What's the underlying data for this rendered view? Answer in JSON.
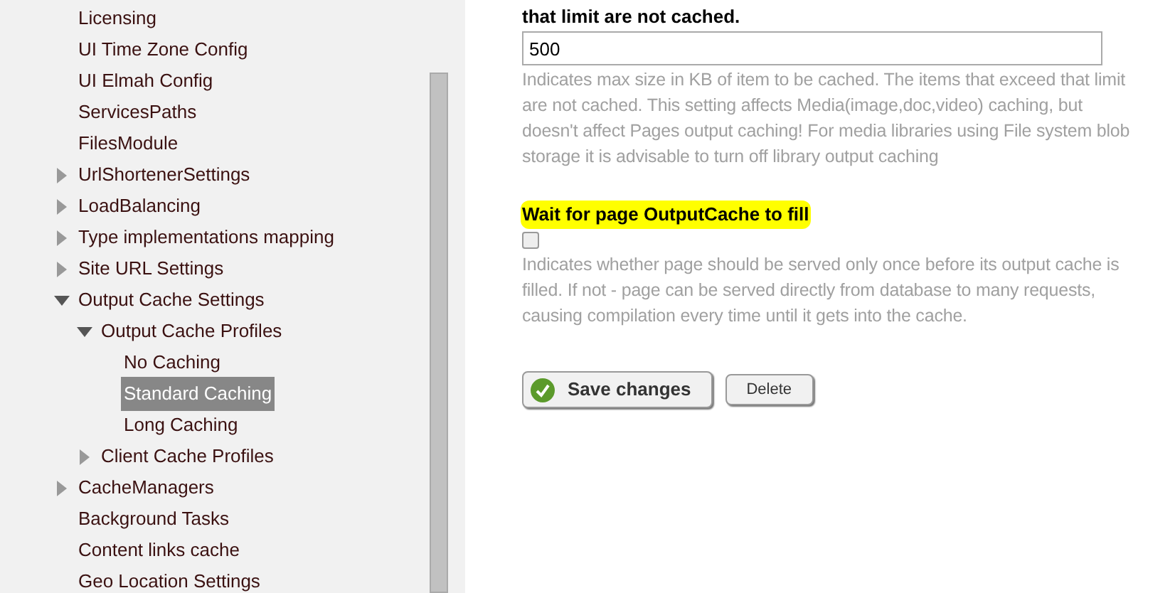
{
  "sidebar": {
    "tree": [
      {
        "label": "Licensing",
        "selected": false
      },
      {
        "label": "UI Time Zone Config",
        "selected": false
      },
      {
        "label": "UI Elmah Config",
        "selected": false
      },
      {
        "label": "ServicesPaths",
        "selected": false
      },
      {
        "label": "FilesModule",
        "selected": false
      },
      {
        "label": "UrlShortenerSettings",
        "selected": false,
        "expanded": false
      },
      {
        "label": "LoadBalancing",
        "selected": false,
        "expanded": false
      },
      {
        "label": "Type implementations mapping",
        "selected": false,
        "expanded": false
      },
      {
        "label": "Site URL Settings",
        "selected": false,
        "expanded": false
      },
      {
        "label": "Output Cache Settings",
        "selected": false,
        "expanded": true,
        "children": [
          {
            "label": "Output Cache Profiles",
            "selected": false,
            "expanded": true,
            "children": [
              {
                "label": "No Caching",
                "selected": false
              },
              {
                "label": "Standard Caching",
                "selected": true
              },
              {
                "label": "Long Caching",
                "selected": false
              }
            ]
          },
          {
            "label": "Client Cache Profiles",
            "selected": false,
            "expanded": false
          }
        ]
      },
      {
        "label": "CacheManagers",
        "selected": false,
        "expanded": false
      },
      {
        "label": "Background Tasks",
        "selected": false
      },
      {
        "label": "Content links cache",
        "selected": false
      },
      {
        "label": "Geo Location Settings",
        "selected": false
      }
    ]
  },
  "form": {
    "fields": [
      {
        "kind": "text",
        "label": "that limit are not cached.",
        "highlighted": false,
        "value": "500",
        "help": "Indicates max size in KB of item to be cached. The items that exceed that limit are not cached. This setting affects Media(image,doc,video) caching, but doesn't affect Pages output caching! For media libraries using File system blob storage it is advisable to turn off library output caching"
      },
      {
        "kind": "checkbox",
        "label": "Wait for page OutputCache to fill",
        "highlighted": true,
        "checked": false,
        "help": "Indicates whether page should be served only once before its output cache is filled. If not - page can be served directly from database to many requests, causing compilation every time until it gets into the cache."
      }
    ],
    "buttons": [
      {
        "kind": "primary",
        "label": "Save changes"
      },
      {
        "kind": "secondary",
        "label": "Delete"
      }
    ]
  }
}
